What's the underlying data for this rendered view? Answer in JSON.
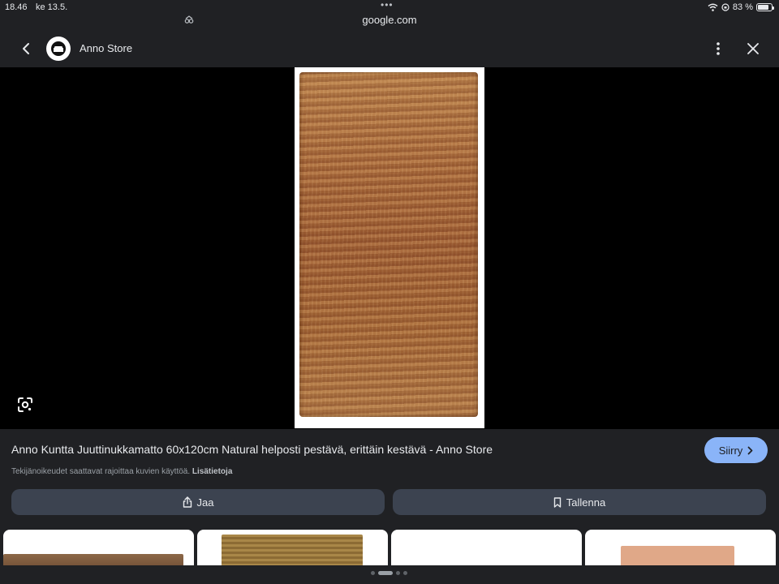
{
  "status": {
    "time": "18.46",
    "date": "ke 13.5.",
    "url": "google.com",
    "battery": "83 %",
    "battery_level": 0.83
  },
  "header": {
    "site_name": "Anno Store"
  },
  "result": {
    "title": "Anno Kuntta Juuttinukkamatto 60x120cm Natural helposti pestävä, erittäin kestävä - Anno Store",
    "visit_label": "Siirry",
    "copyright_text": "Tekijänoikeudet saattavat rajoittaa kuvien käyttöä.",
    "more_info_label": "Lisätietoja",
    "share_label": "Jaa",
    "save_label": "Tallenna"
  },
  "colors": {
    "background": "#202124",
    "accent": "#8ab4f8",
    "button": "#3c4350"
  }
}
